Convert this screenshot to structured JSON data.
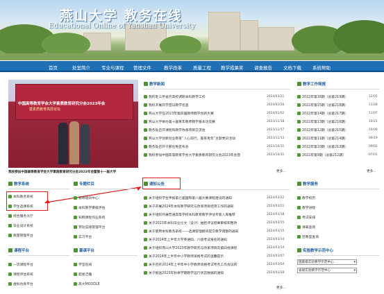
{
  "header": {
    "logo_cn": "燕山大学 教务在线",
    "logo_en": "Educational Online of Yanshan University"
  },
  "nav": {
    "items": [
      "首页",
      "处室简介",
      "专业与课程",
      "管理文件",
      "教学改革",
      "质量工程",
      "教学成果奖",
      "调查报告",
      "文档下载",
      "系统帮助"
    ]
  },
  "hero": {
    "screen_line1": "中国高等教育学会大学素质教育研究分会2023年会",
    "screen_line2": "暨素质教育高层论坛",
    "caption": "我校参加中国高等教育学会大学素质教育研究分会2023年会暨第十一届大学"
  },
  "news": {
    "title": "教学新闻",
    "items": [
      {
        "text": "我校赴三所省内高校调研本科教学工作",
        "date": "2024/03/21"
      },
      {
        "text": "我校开展开学首日教学巡查",
        "date": "2024/02/26"
      },
      {
        "text": "燕山大学在2023年第四届教师教学创新大赛",
        "date": "2024/01/02"
      },
      {
        "text": "燕山大学举办第十届青年教师教学基本功竞赛",
        "date": "2023/11/18"
      },
      {
        "text": "教务处召开课程和教学改革项目交流会",
        "date": "2023/11/17"
      },
      {
        "text": "燕山大学创新创业教育“入心润行，美育青年”主题党日活动",
        "date": "2023/11/13"
      },
      {
        "text": "教务处召开干部任免宣布会",
        "date": "2023/10/31"
      },
      {
        "text": "我校参加中国高等教育学会大学素质教育研究分会2023年会暨",
        "date": "2023/10/31"
      }
    ],
    "more": "更多..."
  },
  "notices": {
    "title": "通知公告",
    "items": [
      {
        "text": "关于组织学生申报第七届国和第八届大赛课程建设的通知",
        "date": "2024/03/22"
      },
      {
        "text": "关于开展2024年本科教学研究与改革项目结项工作的通知",
        "date": "2024/03/21"
      },
      {
        "text": "关于组织开展普通高等学校本科教育教学评估专家入库推荐",
        "date": "2024/03/18"
      },
      {
        "text": "关于2023年本科毕业论文（设计）抽检评议结果审核和整改",
        "date": "2024/03/15"
      },
      {
        "text": "关于使用本科教务系统——选课管理模块提交教学调整的通知",
        "date": "2024/03/15"
      },
      {
        "text": "关于2024年上半年大学英语四、六级考试报名的通知",
        "date": "2024/03/14"
      },
      {
        "text": "关于组织燕山大学2023年教学研究与改革项目及第四批课程",
        "date": "2024/03/14"
      },
      {
        "text": "关于2024年上半年中小学教师资格考试的温馨提示",
        "date": "2024/03/07"
      },
      {
        "text": "关于召开2024年上半年中小学教师资格考试考务工作会议的",
        "date": "2024/03/04"
      },
      {
        "text": "关于报送2023年秋季学期教学运行状态数据的通知",
        "date": "2024/02/28"
      }
    ],
    "more": "更多..."
  },
  "weekly": {
    "title": "教学工作简报",
    "items": [
      {
        "text": "2022年第16期（总第219期）",
        "date": "12/05"
      },
      {
        "text": "2022年第15期（总第218期）",
        "date": "11/28"
      },
      {
        "text": "2022年第14期（总第217期）",
        "date": "11/07"
      },
      {
        "text": "2022年第13期（总第216期）",
        "date": "10/21"
      },
      {
        "text": "2022年第12期（总第215期）",
        "date": "10/06"
      },
      {
        "text": "2022年第11期（总第214期）",
        "date": "09/19"
      },
      {
        "text": "2022年第10期（总第213期）",
        "date": "09/02"
      },
      {
        "text": "2022年第9期（总第212期）",
        "date": "07/01"
      }
    ],
    "more": "更多..."
  },
  "teaching_system": {
    "title": "教学系统",
    "items": [
      "本科教务系统",
      "学生选课系统",
      "综合服务大厅",
      "毕业设计系统",
      "质量管理平台"
    ]
  },
  "special": {
    "title": "专题栏目",
    "items": [
      "教师培训中心",
      "本科教学审核评估",
      "知网课程作业系统",
      "劳动实践管理平台",
      "实习平台"
    ]
  },
  "services": {
    "title": "教学服务",
    "items": [
      "教学校历",
      "教学进程",
      "考试安排",
      "课表查询",
      "空教室查询"
    ]
  },
  "course_platform": {
    "title": "课程平台",
    "items": [
      "一流课程平台",
      "课程评估系统",
      "虚拟仿真平台"
    ]
  },
  "resources": {
    "title": "慕课平台",
    "items": [
      "学堂在线",
      "超星泛雅",
      "高大MOODLE"
    ]
  },
  "lab_center": {
    "title": "实验教学示范中心",
    "select1": "国家级实验教学示范中心",
    "select2": "省级实验教学示范中心"
  },
  "colors": {
    "nav": "#1f6fb5",
    "section_icon": "#4f8f2f",
    "highlight_box": "#e02020"
  }
}
